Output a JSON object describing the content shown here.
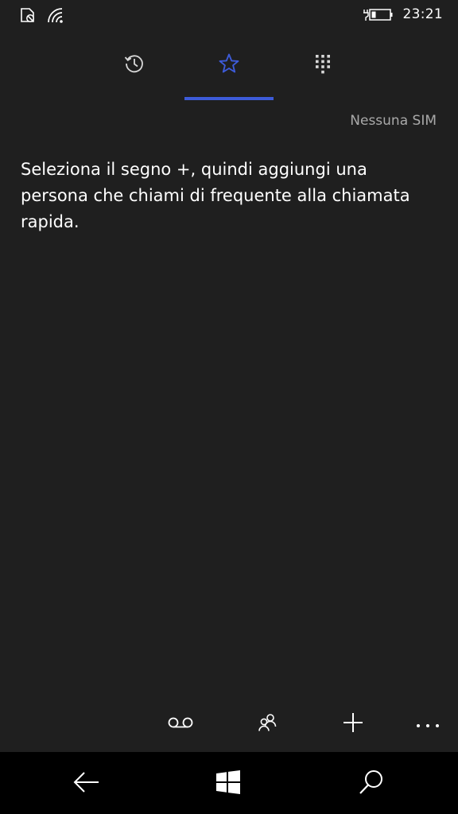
{
  "status_bar": {
    "time": "23:21",
    "icons": [
      "no-sim-icon",
      "wifi-icon",
      "battery-charging-icon"
    ]
  },
  "tabs": [
    {
      "name": "history",
      "icon": "history-icon",
      "active": false
    },
    {
      "name": "speed-dial",
      "icon": "star-icon",
      "active": true
    },
    {
      "name": "keypad",
      "icon": "dialpad-icon",
      "active": false
    }
  ],
  "sim_status": "Nessuna SIM",
  "empty_message": "Seleziona il segno +, quindi aggiungi una persona che chiami di frequente alla chiamata rapida.",
  "app_bar": {
    "buttons": [
      "voicemail-icon",
      "contacts-icon",
      "add-icon",
      "more-icon"
    ]
  },
  "nav_bar": {
    "buttons": [
      "back-icon",
      "windows-icon",
      "search-icon"
    ]
  },
  "colors": {
    "background": "#1f1f1f",
    "accent": "#3d5bd9",
    "secondary_text": "#a9a9a9",
    "nav_background": "#000000"
  }
}
